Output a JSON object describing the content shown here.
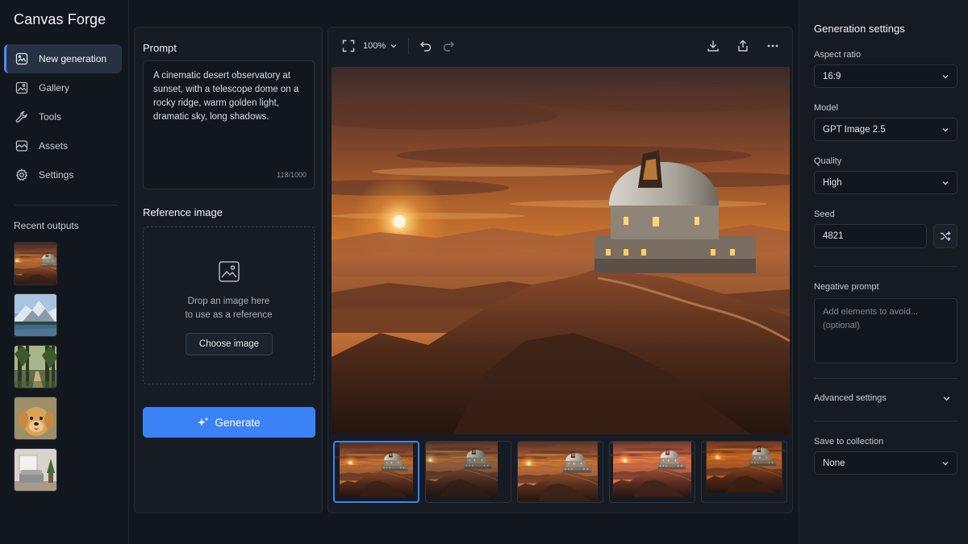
{
  "app": {
    "title": "Canvas Forge"
  },
  "sidebar": {
    "items": [
      {
        "label": "New generation",
        "icon": "image-edit-icon",
        "active": true
      },
      {
        "label": "Gallery",
        "icon": "gallery-icon"
      },
      {
        "label": "Tools",
        "icon": "wrench-icon"
      },
      {
        "label": "Assets",
        "icon": "assets-icon"
      },
      {
        "label": "Settings",
        "icon": "gear-icon"
      }
    ],
    "recent_title": "Recent outputs",
    "recent": [
      "desert-observatory",
      "snowy-mountain-lake",
      "forest-path",
      "golden-retriever",
      "living-room-interior"
    ]
  },
  "prompt": {
    "label": "Prompt",
    "text": "A cinematic desert observatory at sunset, with a telescope dome on a rocky ridge, warm golden light, dramatic sky, long shadows.",
    "count": "118/1000"
  },
  "reference": {
    "label": "Reference image",
    "drop_line1": "Drop an image here",
    "drop_line2": "to use as a reference",
    "choose_label": "Choose image"
  },
  "generate": {
    "label": "Generate"
  },
  "toolbar": {
    "zoom": "100%"
  },
  "variants": {
    "count": 5,
    "selected_index": 0
  },
  "settings": {
    "title": "Generation settings",
    "aspect_label": "Aspect ratio",
    "aspect_value": "16:9",
    "model_label": "Model",
    "model_value": "GPT Image 2.5",
    "quality_label": "Quality",
    "quality_value": "High",
    "seed_label": "Seed",
    "seed_value": "4821",
    "negative_label": "Negative prompt",
    "negative_placeholder": "Add elements to avoid...\n(optional)",
    "advanced_label": "Advanced settings",
    "collection_label": "Save to collection",
    "collection_value": "None"
  },
  "colors": {
    "accent": "#3b82f6",
    "background": "#12161d",
    "panel": "#171c24"
  }
}
